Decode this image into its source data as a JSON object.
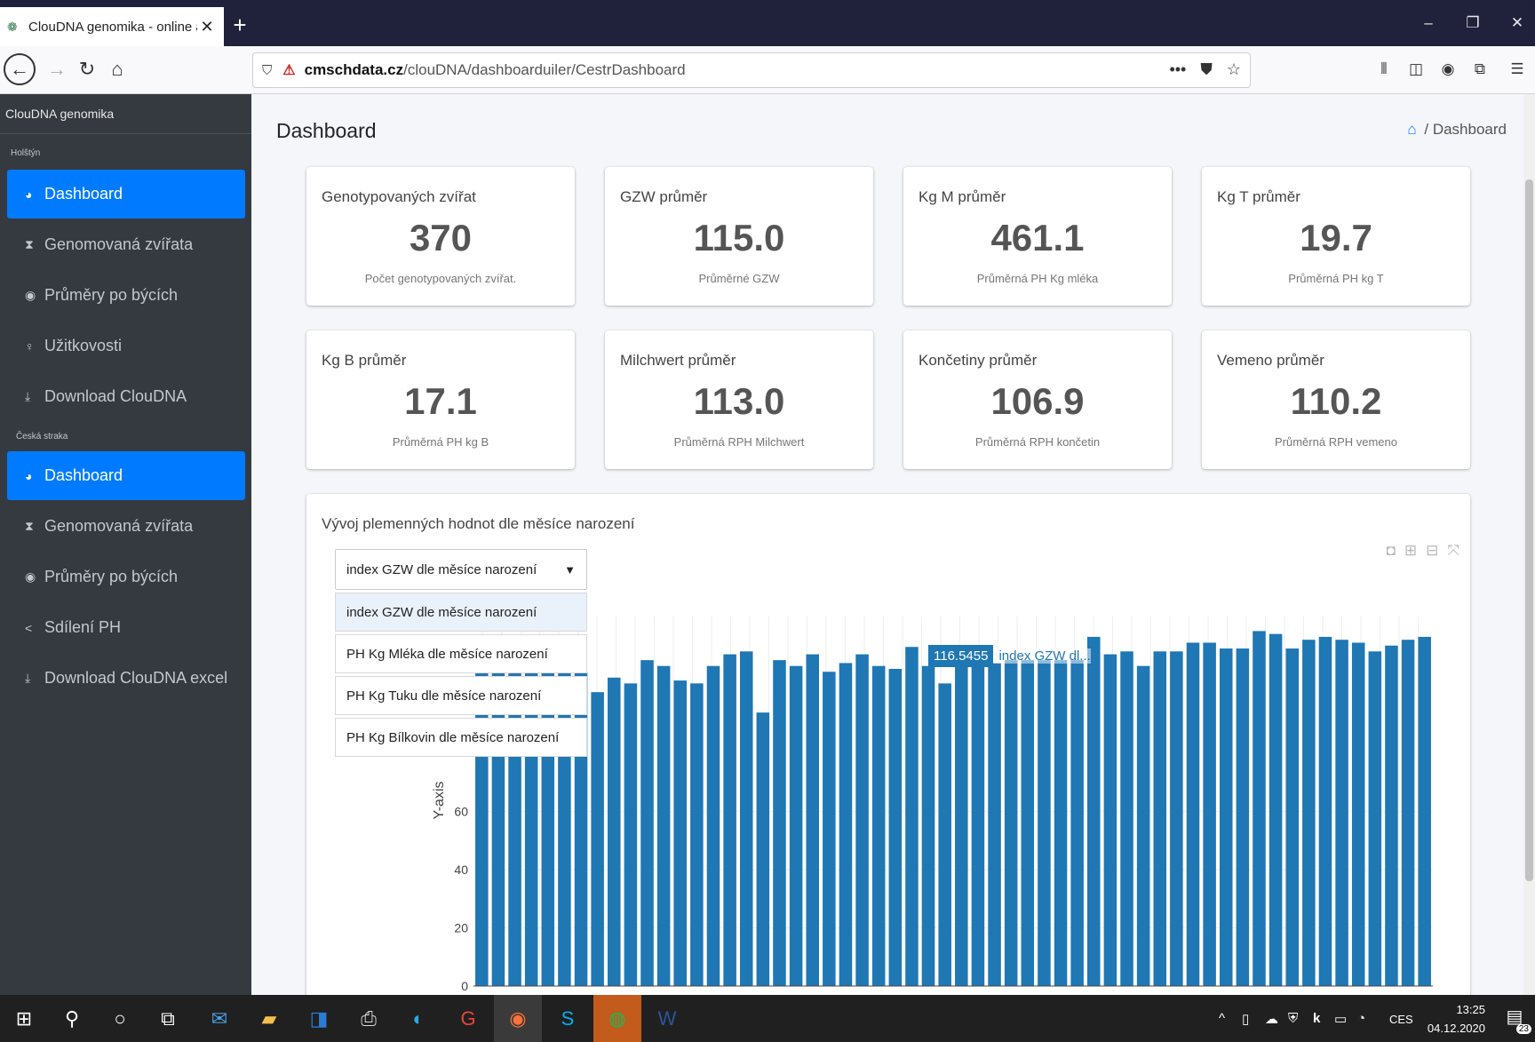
{
  "browser": {
    "tab_title": "ClouDNA genomika - online ap",
    "url_host": "cmschdata.cz",
    "url_path": "/clouDNA/dashboarduiler/CestrDashboard"
  },
  "sidebar": {
    "brand": "ClouDNA genomika",
    "section1": {
      "label": "Holštýn",
      "items": [
        {
          "label": "Dashboard",
          "icon": "tachometer-icon"
        },
        {
          "label": "Genomovaná zvířata",
          "icon": "hourglass-icon"
        },
        {
          "label": "Průměry po býcích",
          "icon": "dot-circle-icon"
        },
        {
          "label": "Užitkovosti",
          "icon": "female-icon"
        },
        {
          "label": "Download ClouDNA",
          "icon": "download-icon"
        }
      ]
    },
    "section2": {
      "label": "Česká straka",
      "items": [
        {
          "label": "Dashboard",
          "icon": "tachometer-icon"
        },
        {
          "label": "Genomovaná zvířata",
          "icon": "hourglass-icon"
        },
        {
          "label": "Průměry po býcích",
          "icon": "dot-circle-icon"
        },
        {
          "label": "Sdílení PH",
          "icon": "share-icon"
        },
        {
          "label": "Download ClouDNA excel",
          "icon": "download-icon"
        }
      ]
    }
  },
  "header": {
    "title": "Dashboard",
    "breadcrumb": "/ Dashboard"
  },
  "cards": [
    {
      "title": "Genotypovaných zvířat",
      "value": "370",
      "sub": "Počet genotypovaných zvířat."
    },
    {
      "title": "GZW průměr",
      "value": "115.0",
      "sub": "Průměrné GZW"
    },
    {
      "title": "Kg M průměr",
      "value": "461.1",
      "sub": "Průměrná PH Kg mléka"
    },
    {
      "title": "Kg T průměr",
      "value": "19.7",
      "sub": "Průměrná PH kg T"
    },
    {
      "title": "Kg B průměr",
      "value": "17.1",
      "sub": "Průměrná PH kg B"
    },
    {
      "title": "Milchwert průměr",
      "value": "113.0",
      "sub": "Průměrná RPH Milchwert"
    },
    {
      "title": "Končetiny průměr",
      "value": "106.9",
      "sub": "Průměrná RPH končetin"
    },
    {
      "title": "Vemeno průměr",
      "value": "110.2",
      "sub": "Průměrná RPH vemeno"
    }
  ],
  "chart_section": {
    "title": "Vývoj plemenných hodnot dle měsíce narození",
    "select_value": "index GZW dle měsíce narození",
    "options": [
      "index GZW dle měsíce narození",
      "PH Kg Mléka dle měsíce narození",
      "PH Kg Tuku dle měsíce narození",
      "PH Kg Bílkovin dle měsíce narození"
    ],
    "tooltip_value": "116.5455",
    "tooltip_name": "index GZW dl..."
  },
  "chart_data": {
    "type": "bar",
    "ylabel": "Y-axis",
    "y_ticks": [
      0,
      20,
      40,
      60
    ],
    "ylim": [
      0,
      127
    ],
    "grid": true,
    "color": "#1f77b4",
    "values": [
      110,
      110,
      110,
      110,
      110,
      110,
      108,
      101,
      106,
      104,
      112,
      110,
      105,
      104,
      110,
      114,
      115,
      94,
      112,
      110,
      114,
      108,
      111,
      114,
      110,
      109,
      116.5455,
      110,
      104,
      112,
      110,
      111,
      112,
      112,
      112,
      112,
      112,
      120,
      114,
      115,
      110,
      115,
      115,
      118,
      118,
      116,
      116,
      122,
      121,
      116,
      119,
      120,
      119,
      118,
      115,
      117,
      119,
      120
    ]
  },
  "taskbar": {
    "clock_time": "13:25",
    "clock_date": "04.12.2020",
    "lang": "CES",
    "notif_count": "23"
  }
}
